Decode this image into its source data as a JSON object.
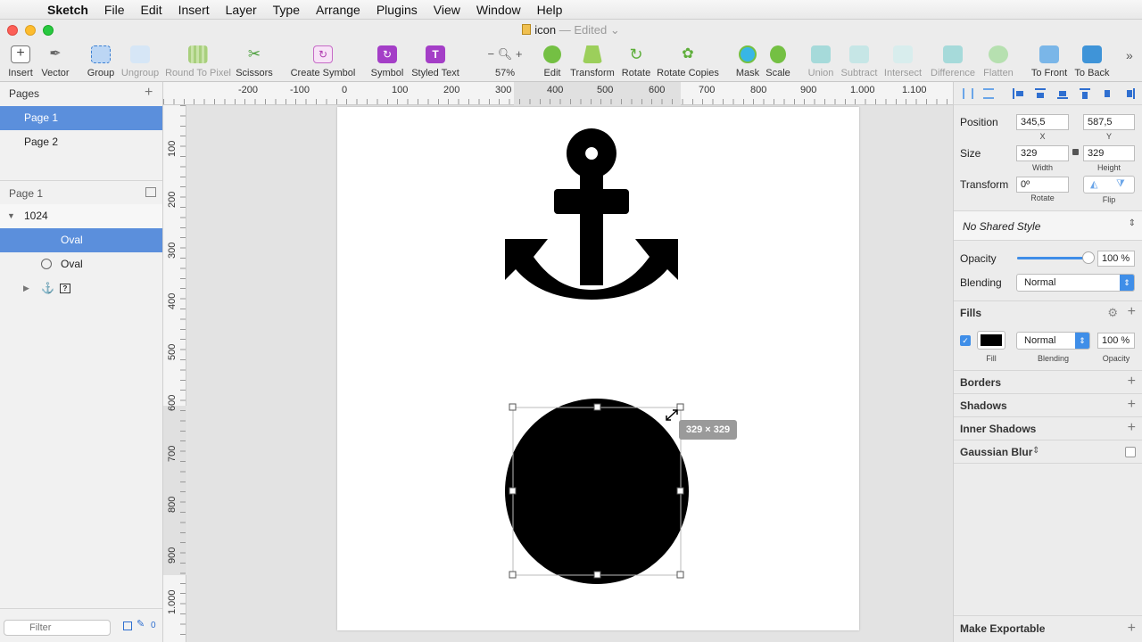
{
  "menubar": {
    "app_name": "Sketch",
    "items": [
      "File",
      "Edit",
      "Insert",
      "Layer",
      "Type",
      "Arrange",
      "Plugins",
      "View",
      "Window",
      "Help"
    ]
  },
  "window": {
    "title": "icon",
    "title_suffix": "— Edited"
  },
  "toolbar": {
    "insert": "Insert",
    "vector": "Vector",
    "group": "Group",
    "ungroup": "Ungroup",
    "round_to_pixel": "Round To Pixel",
    "scissors": "Scissors",
    "create_symbol": "Create Symbol",
    "symbol": "Symbol",
    "styled_text": "Styled Text",
    "zoom": "57%",
    "edit": "Edit",
    "transform": "Transform",
    "rotate": "Rotate",
    "rotate_copies": "Rotate Copies",
    "mask": "Mask",
    "scale": "Scale",
    "union": "Union",
    "subtract": "Subtract",
    "intersect": "Intersect",
    "difference": "Difference",
    "flatten": "Flatten",
    "to_front": "To Front",
    "to_back": "To Back"
  },
  "pages": {
    "header": "Pages",
    "items": [
      "Page 1",
      "Page 2"
    ]
  },
  "layers": {
    "header": "Page 1",
    "artboard": "1024",
    "items": [
      "Oval",
      "Oval"
    ]
  },
  "filter": {
    "placeholder": "Filter",
    "count": "0"
  },
  "rulers": {
    "h": [
      "-200",
      "-100",
      "0",
      "100",
      "200",
      "300",
      "400",
      "500",
      "600",
      "700",
      "800",
      "900",
      "1.000",
      "1.100"
    ],
    "v": [
      "100",
      "200",
      "300",
      "400",
      "500",
      "600",
      "700",
      "800",
      "900",
      "1.000"
    ]
  },
  "canvas": {
    "size_tooltip": "329 × 329"
  },
  "inspector": {
    "position_label": "Position",
    "x": "345,5",
    "y": "587,5",
    "x_lbl": "X",
    "y_lbl": "Y",
    "size_label": "Size",
    "width": "329",
    "height": "329",
    "width_lbl": "Width",
    "height_lbl": "Height",
    "transform_label": "Transform",
    "rotate_value": "0º",
    "rotate_lbl": "Rotate",
    "flip_lbl": "Flip",
    "shared_style": "No Shared Style",
    "opacity_label": "Opacity",
    "opacity_value": "100 %",
    "opacity_level": 1.0,
    "blending_label": "Blending",
    "blending_value": "Normal",
    "fills_header": "Fills",
    "fill_color": "#000000",
    "fill_blending": "Normal",
    "fill_opacity": "100 %",
    "fill_lbl": "Fill",
    "blending_lbl": "Blending",
    "opacity_lbl": "Opacity",
    "borders": "Borders",
    "shadows": "Shadows",
    "inner_shadows": "Inner Shadows",
    "gaussian_blur": "Gaussian Blur",
    "make_exportable": "Make Exportable"
  }
}
